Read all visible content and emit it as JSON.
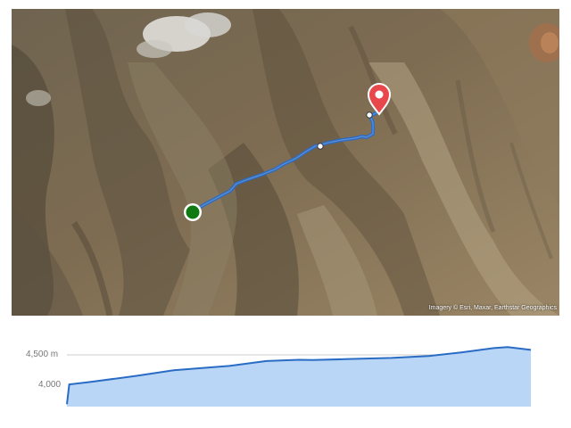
{
  "map": {
    "attribution": "Imagery © Esri, Maxar, Earthstar Geographics",
    "route_color": "#2f6bbf",
    "start_marker": {
      "icon": "start-dot-icon",
      "color": "#0f7a12"
    },
    "end_marker": {
      "icon": "map-pin-icon",
      "color": "#e8474b"
    },
    "waypoints": [
      "waypoint-dot",
      "waypoint-dot"
    ]
  },
  "chart_data": {
    "type": "area",
    "title": "",
    "xlabel": "",
    "ylabel": "",
    "y_ticks": [
      "4,500 m",
      "4,000"
    ],
    "y_unit": "m",
    "ylim": [
      3700,
      4800
    ],
    "grid": true,
    "fill_color": "#b9d6f7",
    "line_color": "#2a6cc4",
    "x": [
      0,
      0.005,
      0.05,
      0.15,
      0.23,
      0.35,
      0.43,
      0.5,
      0.53,
      0.6,
      0.7,
      0.78,
      0.85,
      0.92,
      0.95,
      1.0
    ],
    "y": [
      3740,
      4060,
      4100,
      4200,
      4290,
      4360,
      4440,
      4460,
      4455,
      4470,
      4490,
      4520,
      4580,
      4650,
      4665,
      4620
    ]
  }
}
